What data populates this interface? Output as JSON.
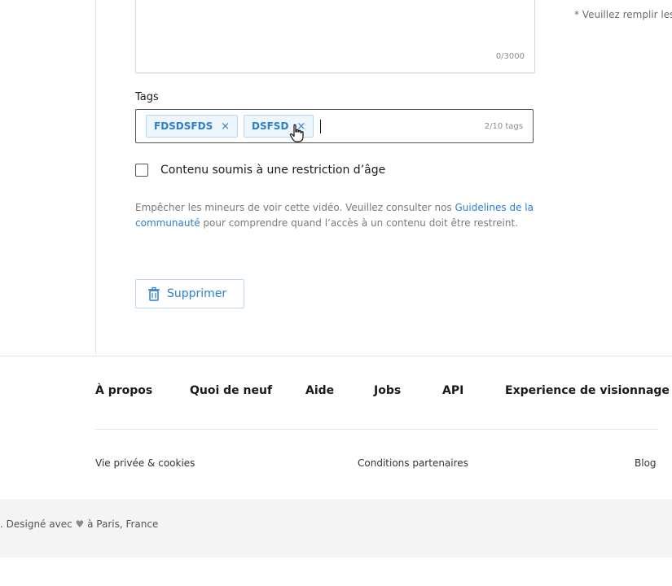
{
  "description_field": {
    "char_counter": "0/3000",
    "required_note": "* Veuillez remplir les"
  },
  "tags": {
    "label": "Tags",
    "chips": [
      "FDSDSFDS",
      "DSFSD"
    ],
    "chip_remove_glyph": "×",
    "count": "2/10 tags"
  },
  "age_restriction": {
    "label": "Contenu soumis à une restriction d’âge",
    "help_before_link": "Empêcher les mineurs de voir cette vidéo. Veuillez consulter nos ",
    "help_link": "Guidelines de la communauté",
    "help_after_link": " pour comprendre quand l’accès à un contenu doit être restreint."
  },
  "delete_button": {
    "label": "Supprimer",
    "icon": "trash-icon"
  },
  "footer": {
    "nav": [
      "À propos",
      "Quoi de neuf",
      "Aide",
      "Jobs",
      "API",
      "Experience de visionnage"
    ],
    "secondary": [
      "Vie privée & cookies",
      "Conditions partenaires",
      "Blog"
    ],
    "made_in_before": ". Designé avec ",
    "made_in_after": " à Paris, France",
    "heart_icon": "heart-icon"
  },
  "colors": {
    "accent": "#2c7fd0",
    "chip_background": "#edf5fd",
    "footer_band": "#f4f4f4"
  }
}
